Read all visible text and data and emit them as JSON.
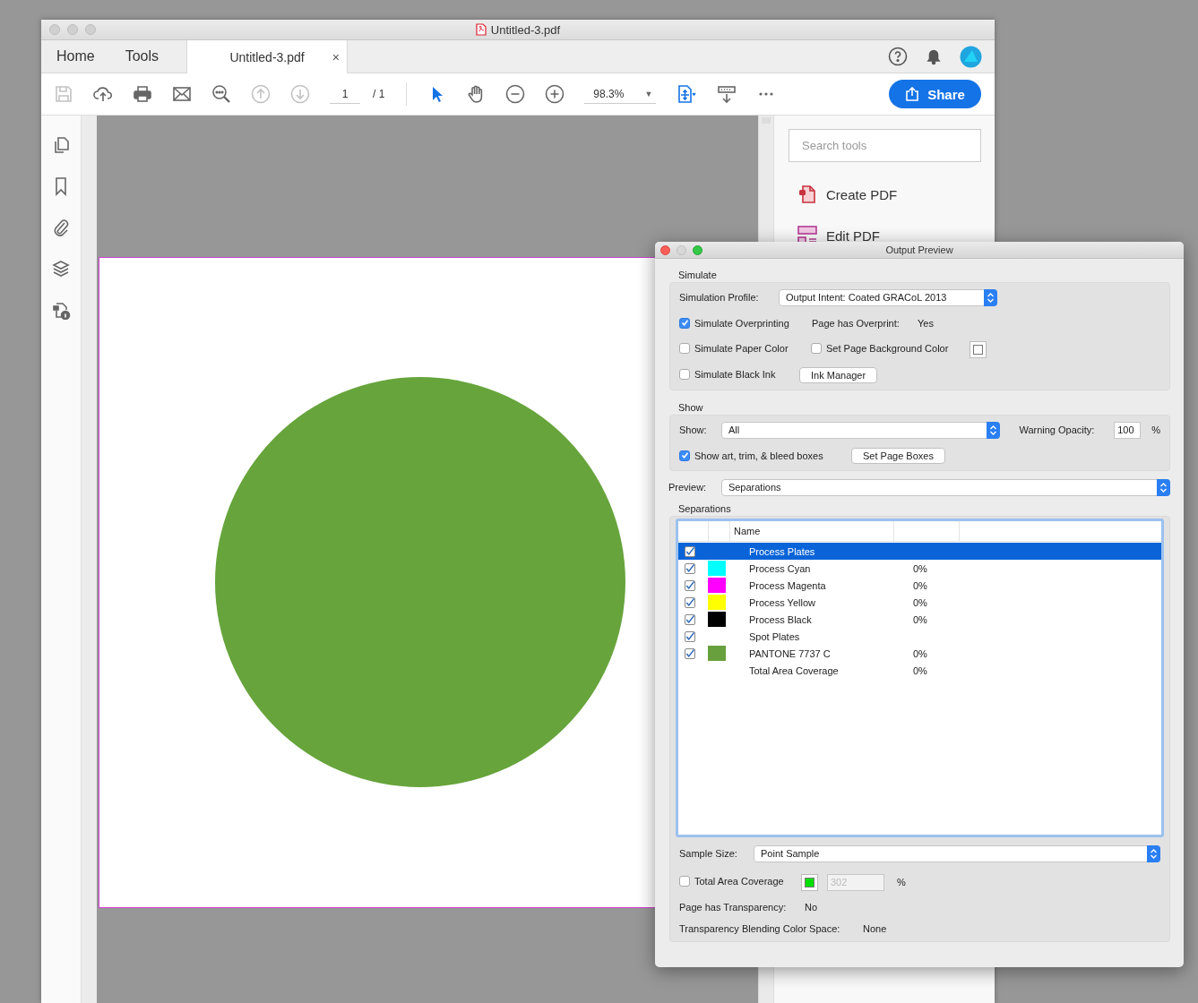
{
  "window": {
    "title": "Untitled-3.pdf"
  },
  "tabs": [
    {
      "label": "Home",
      "selected": false
    },
    {
      "label": "Tools",
      "selected": false
    },
    {
      "label": "Untitled-3.pdf",
      "selected": true,
      "close": "×"
    }
  ],
  "toolbar": {
    "page_current": "1",
    "page_total": "/ 1",
    "zoom": "98.3%",
    "zoom_caret": "▼",
    "share_button": "Share"
  },
  "tools_pane": {
    "search": {
      "placeholder": "Search tools"
    },
    "items": [
      {
        "label": "Create PDF"
      },
      {
        "label": "Edit PDF"
      }
    ]
  },
  "dialog": {
    "title": "Output Preview",
    "simulate": {
      "heading": "Simulate",
      "profile_label": "Simulation Profile:",
      "profile_value": "Output Intent: Coated GRACoL 2013",
      "simulate_overprinting": {
        "label": "Simulate Overprinting",
        "checked": true
      },
      "overprint_label": "Page has Overprint:",
      "overprint_value": "Yes",
      "simulate_paper_color": {
        "label": "Simulate Paper Color",
        "checked": false
      },
      "set_page_background_color": {
        "label": "Set Page Background Color",
        "checked": false
      },
      "simulate_black_ink": {
        "label": "Simulate Black Ink",
        "checked": false
      },
      "ink_manager_button": "Ink Manager"
    },
    "show": {
      "heading": "Show",
      "show_label": "Show:",
      "show_value": "All",
      "warning_opacity_label": "Warning Opacity:",
      "warning_opacity_value": "100",
      "percent": "%",
      "show_boxes": {
        "label": "Show art, trim, & bleed boxes",
        "checked": true
      },
      "set_page_boxes_button": "Set Page Boxes"
    },
    "preview_label": "Preview:",
    "preview_value": "Separations",
    "separations": {
      "heading": "Separations",
      "columns": [
        "Name"
      ],
      "rows": [
        {
          "kind": "plate",
          "name": "Process Plates",
          "checked": true,
          "selected": true
        },
        {
          "kind": "plate",
          "name": "Process Cyan",
          "checked": true,
          "selected": false,
          "color": "#00ffff",
          "coverage": "0%"
        },
        {
          "kind": "plate",
          "name": "Process Magenta",
          "checked": true,
          "selected": false,
          "color": "#ff00ff",
          "coverage": "0%"
        },
        {
          "kind": "plate",
          "name": "Process Yellow",
          "checked": true,
          "selected": false,
          "color": "#ffff00",
          "coverage": "0%"
        },
        {
          "kind": "plate",
          "name": "Process Black",
          "checked": true,
          "selected": false,
          "color": "#000000",
          "coverage": "0%"
        },
        {
          "kind": "plate",
          "name": "Spot Plates",
          "checked": true,
          "selected": false
        },
        {
          "kind": "plate",
          "name": "PANTONE 7737 C",
          "checked": true,
          "selected": false,
          "color": "#67a03d",
          "coverage": "0%"
        },
        {
          "kind": "total",
          "name": "Total Area Coverage",
          "selected": false,
          "coverage": "0%"
        }
      ]
    },
    "sample_size_label": "Sample Size:",
    "sample_size_value": "Point Sample",
    "total_area_coverage": {
      "label": "Total Area Coverage",
      "checked": false,
      "color": "#00e000",
      "value": "302",
      "disabled": true,
      "percent": "%"
    },
    "transparency_label": "Page has Transparency:",
    "transparency_value": "No",
    "blending_label": "Transparency Blending Color Space:",
    "blending_value": "None"
  }
}
